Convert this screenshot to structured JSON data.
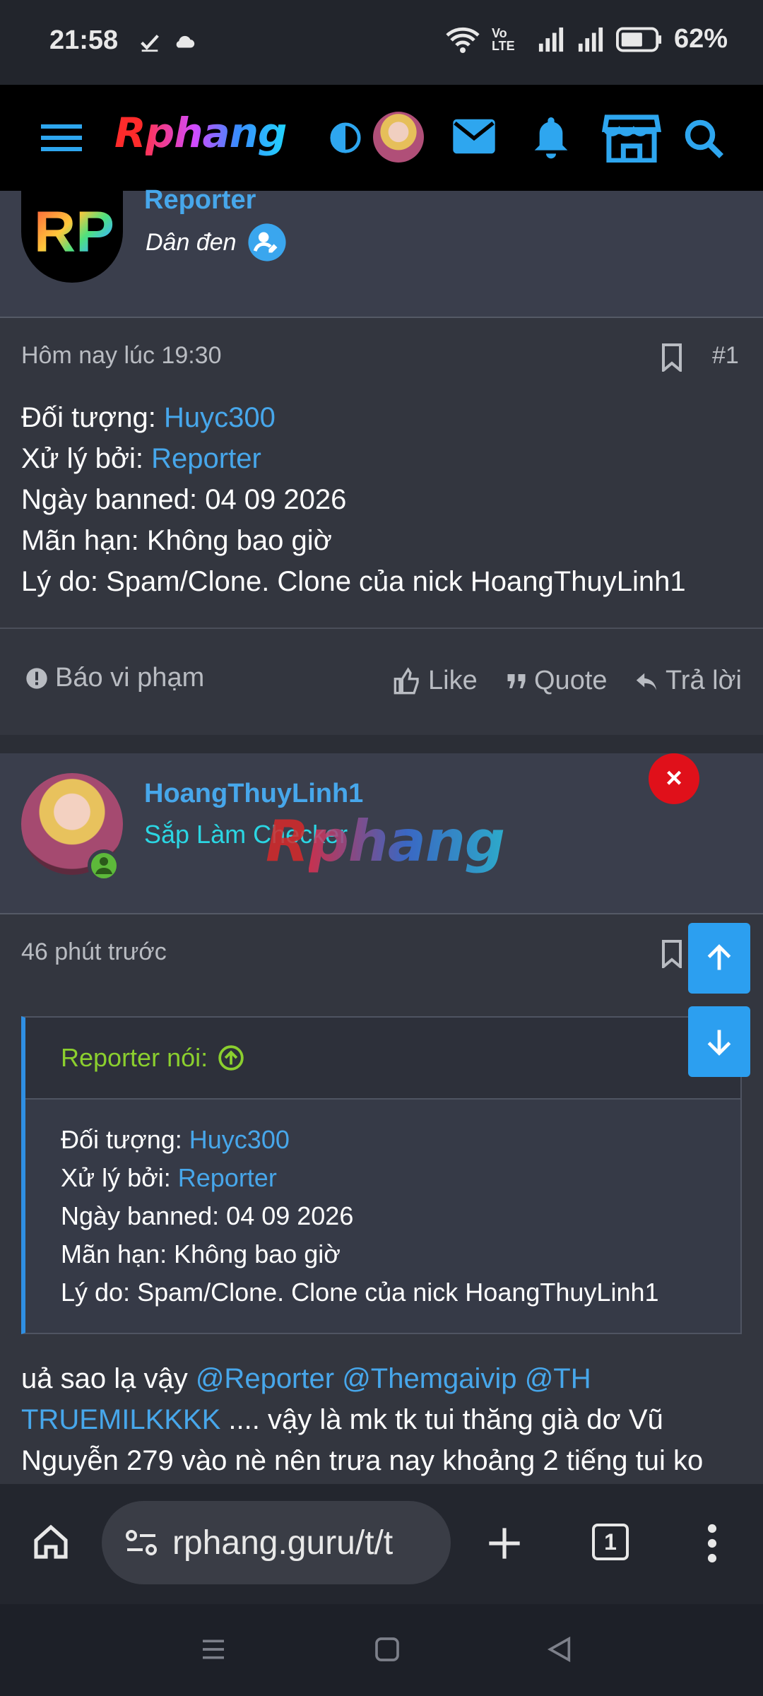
{
  "status_bar": {
    "time": "21:58",
    "battery": "62%",
    "network": "Vo LTE"
  },
  "header": {
    "logo_r": "R",
    "logo_rest": "phang"
  },
  "post1_author": {
    "name": "Reporter",
    "title": "Dân đen",
    "avatar_text": "RP"
  },
  "post1": {
    "date": "Hôm nay lúc 19:30",
    "number": "#1",
    "lines": [
      {
        "label": "Đối tượng: ",
        "value": "Huyc300",
        "link": true
      },
      {
        "label": "Xử lý bởi: ",
        "value": "Reporter",
        "link": true
      },
      {
        "label": "Ngày banned: 04 09 2026",
        "value": "",
        "link": false
      },
      {
        "label": "Mãn hạn: Không bao giờ",
        "value": "",
        "link": false
      },
      {
        "label": "Lý do: Spam/Clone. Clone của nick HoangThuyLinh1",
        "value": "",
        "link": false
      }
    ],
    "report": "Báo vi phạm",
    "like": "Like",
    "quote": "Quote",
    "reply": "Trả lời"
  },
  "post2_author": {
    "name": "HoangThuyLinh1",
    "title": "Sắp Làm Checker"
  },
  "post2": {
    "date": "46 phút trước",
    "quote_header": "Reporter nói:",
    "quote_lines": {
      "l1_label": "Đối tượng: ",
      "l1_value": "Huyc300",
      "l2_label": "Xử lý bởi: ",
      "l2_value": "Reporter",
      "l3": "Ngày banned: 04 09 2026",
      "l4": "Mãn hạn: Không bao giờ",
      "l5": "Lý do: Spam/Clone. Clone của nick HoangThuyLinh1"
    },
    "body_start": "uả sao lạ vậy ",
    "mention1": "@Reporter",
    "mention2": "@Themgaivip",
    "mention3a": "@TH",
    "mention3b": "TRUEMILKKKK",
    "body_mid": " .... vậy là mk tk tui thăng già dơ Vũ",
    "body_end": "Nguyễn 279 vào nè nên trưa nay khoảng 2 tiếng tui ko"
  },
  "watermark": {
    "r": "R",
    "rest": "phang"
  },
  "browser": {
    "url": "rphang.guru/t/t",
    "tab_count": "1"
  },
  "close_symbol": "×"
}
